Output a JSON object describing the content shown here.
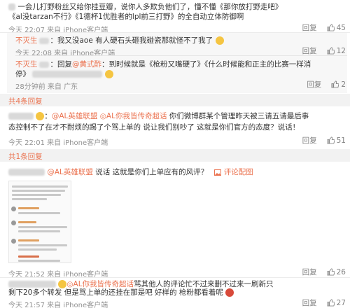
{
  "post1": {
    "text_line1": "一会儿打野粉丝又给你挂豆瓣，说你人多欺负他们了，懂不懂《那你放打野走吧》",
    "text_line2": "《al没tarzan不行》《1德杯1优胜者的lpl前三打野》的全自动立体防御啊",
    "meta": "今天 22:07 来自 iPhone客户端",
    "reply_label": "回复",
    "like_count": "45"
  },
  "sub1": {
    "user": "不灭生",
    "text": "：我又没aoe 有人硬石头砸我碰瓷那就怪不了我了",
    "meta": "今天 22:08 来自 iPhone客户端",
    "reply_label": "回复",
    "like_count": "12"
  },
  "sub2": {
    "user": "不灭生",
    "text_a": "：回复",
    "mention": "@黄式酢",
    "text_b": "：到时候就是《枪粉又嘴硬了》《什么时候能和正主的比赛一样消",
    "text_line2": "停》",
    "meta": "28分钟前 来自 广东",
    "reply_label": "回复",
    "like_count": "2"
  },
  "expand1": "共4条回复",
  "post2": {
    "to_label": "：",
    "mention1": "@AL英雄联盟",
    "mention2": "AL你我皆传奇超话",
    "text_a": "你们微博群某个管理昨天被三请五请最后事",
    "text_line2": "态控制不了在才不耐烦的踢了个骂上单的 说让我们别吵了 这就是你们官方的态度？说话！",
    "meta": "今天 22:01 来自 iPhone客户端",
    "reply_label": "回复",
    "like_count": "51"
  },
  "expand2": "共1条回复",
  "post3": {
    "mention": "@AL英雄联盟",
    "text": "说话 这就是你们上单应有的风评？",
    "picture_link": "评论配图",
    "meta": "今天 21:52 来自 iPhone客户端",
    "reply_label": "回复",
    "like_count": "26"
  },
  "post4": {
    "mention": "AL你我皆传奇超话",
    "text_a": "骂其他人的评论忙不过来删不过来一刷新只",
    "text_line2": "剩下20多个转发 但是骂上单的还挂在那是吧 好样的 枪粉都看着呢",
    "meta": "今天 21:57 来自 iPhone客户端",
    "reply_label": "回复",
    "like_count": "27"
  }
}
